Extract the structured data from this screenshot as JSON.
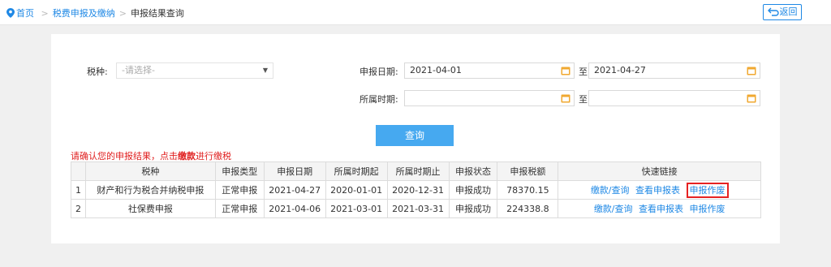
{
  "breadcrumb": {
    "home": "首页",
    "level1": "税费申报及缴纳",
    "current": "申报结果查询",
    "separator": ">"
  },
  "back_button": {
    "label": "返回"
  },
  "form": {
    "tax_type_label": "税种:",
    "tax_type_placeholder": "-请选择-",
    "declare_date_label": "申报日期:",
    "declare_date_start": "2021-04-01",
    "to_label": "至",
    "declare_date_end": "2021-04-27",
    "period_label": "所属时期:",
    "period_start": "",
    "period_end": "",
    "query_button": "查询"
  },
  "notice": {
    "before": "请确认您的申报结果，点击",
    "bold": "缴款",
    "after": "进行缴税"
  },
  "table": {
    "headers": [
      "",
      "税种",
      "申报类型",
      "申报日期",
      "所属时期起",
      "所属时期止",
      "申报状态",
      "申报税额",
      "快速链接"
    ],
    "rows": [
      {
        "index": "1",
        "tax": "财产和行为税合并纳税申报",
        "type": "正常申报",
        "date": "2021-04-27",
        "period_start": "2020-01-01",
        "period_end": "2020-12-31",
        "status": "申报成功",
        "amount": "78370.15",
        "links": [
          "缴款/查询",
          "查看申报表",
          "申报作废"
        ]
      },
      {
        "index": "2",
        "tax": "社保费申报",
        "type": "正常申报",
        "date": "2021-04-06",
        "period_start": "2021-03-01",
        "period_end": "2021-03-31",
        "status": "申报成功",
        "amount": "224338.8",
        "links": [
          "缴款/查询",
          "查看申报表",
          "申报作废"
        ]
      }
    ]
  },
  "colors": {
    "link": "#1e88e5",
    "query_button": "#46a9f0",
    "notice": "#e02020",
    "highlight_box": "#e62222",
    "calendar_icon": "#f0a830"
  }
}
